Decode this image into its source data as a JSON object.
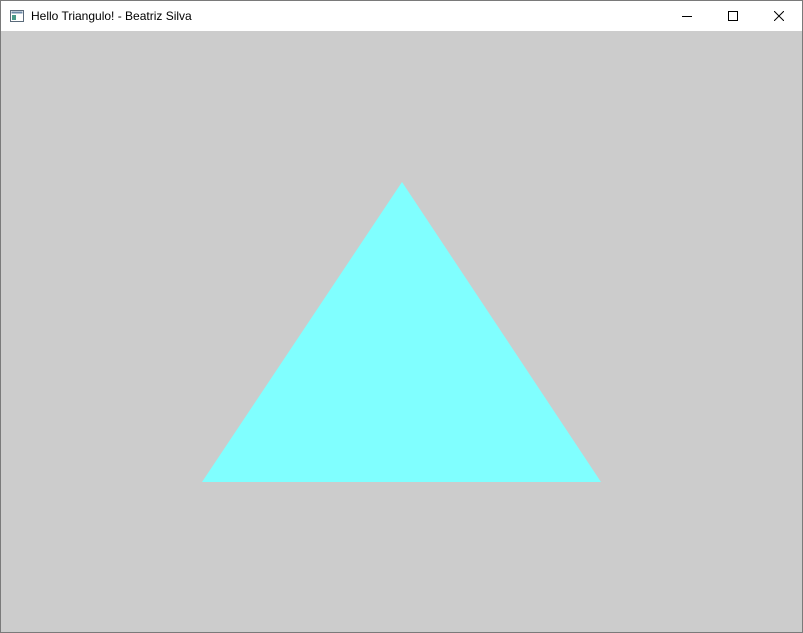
{
  "window": {
    "title": "Hello Triangulo! - Beatriz Silva",
    "icon": "app-window-icon",
    "controls": {
      "minimize": "minimize-icon",
      "maximize": "maximize-icon",
      "close": "close-icon"
    }
  },
  "scene": {
    "background_color": "#cccccc",
    "triangle_color": "#80ffff"
  }
}
